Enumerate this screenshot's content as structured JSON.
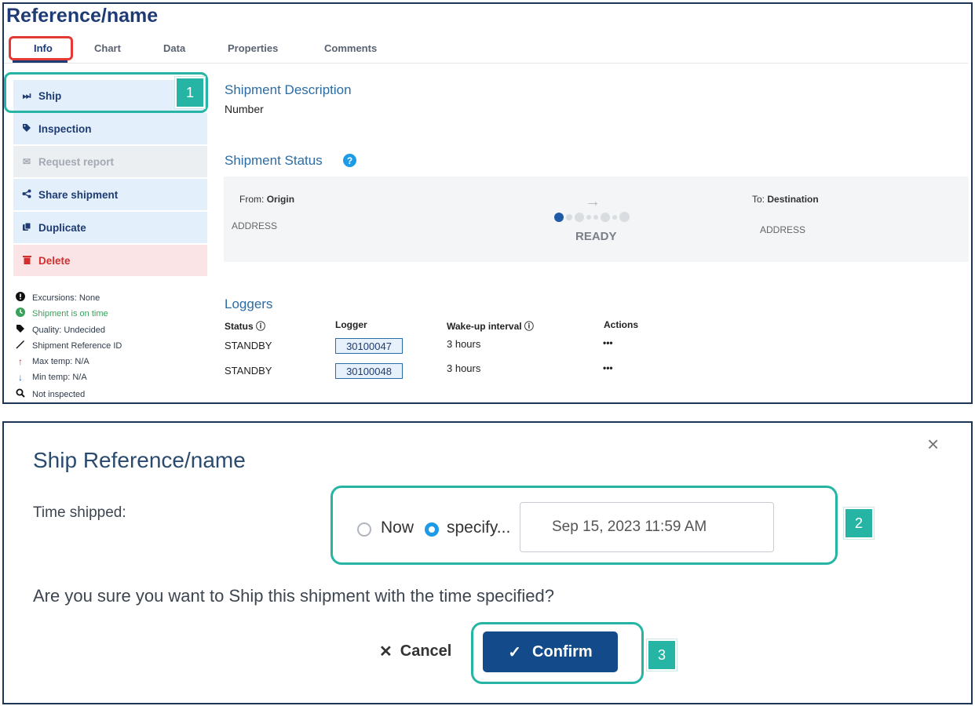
{
  "header": {
    "title": "Reference/name"
  },
  "tabs": [
    "Info",
    "Chart",
    "Data",
    "Properties",
    "Comments"
  ],
  "sidebar": {
    "actions": [
      {
        "label": "Ship",
        "icon": "fast-forward-icon"
      },
      {
        "label": "Inspection",
        "icon": "tag-icon"
      },
      {
        "label": "Request report",
        "icon": "envelope-icon"
      },
      {
        "label": "Share shipment",
        "icon": "share-icon"
      },
      {
        "label": "Duplicate",
        "icon": "copy-icon"
      },
      {
        "label": "Delete",
        "icon": "trash-icon"
      }
    ],
    "status": [
      {
        "text": "Excursions: None",
        "icon": "exclamation-icon"
      },
      {
        "text": "Shipment is on time",
        "icon": "clock-icon"
      },
      {
        "text": "Quality: Undecided",
        "icon": "tag-icon"
      },
      {
        "text": "Shipment Reference ID",
        "icon": "pen-icon"
      },
      {
        "text": "Max temp: N/A",
        "icon": "arrow-up-icon"
      },
      {
        "text": "Min temp: N/A",
        "icon": "arrow-down-icon"
      },
      {
        "text": "Not inspected",
        "icon": "search-icon"
      }
    ]
  },
  "callouts": {
    "one": "1",
    "two": "2",
    "three": "3"
  },
  "description": {
    "heading": "Shipment Description",
    "label": "Number"
  },
  "status": {
    "heading": "Shipment Status",
    "from_label": "From:",
    "from_value": "Origin",
    "from_address": "ADDRESS",
    "to_label": "To:",
    "to_value": "Destination",
    "to_address": "ADDRESS",
    "state": "READY"
  },
  "loggers": {
    "heading": "Loggers",
    "columns": [
      "Status ⓘ",
      "Logger",
      "Wake-up interval ⓘ",
      "Actions"
    ],
    "rows": [
      {
        "status": "STANDBY",
        "logger": "30100047",
        "interval": "3 hours",
        "actions": "•••"
      },
      {
        "status": "STANDBY",
        "logger": "30100048",
        "interval": "3 hours",
        "actions": "•••"
      }
    ]
  },
  "dialog": {
    "title": "Ship Reference/name",
    "time_label": "Time shipped:",
    "radio_now": "Now",
    "radio_specify": "specify...",
    "date_value": "Sep 15, 2023 11:59 AM",
    "question": "Are you sure you want to Ship this shipment with the time specified?",
    "cancel": "Cancel",
    "confirm": "Confirm"
  },
  "colors": {
    "accent": "#1f3b73",
    "teal_callout": "#26b5a5",
    "confirm_bg": "#124a8a",
    "delete": "#d32f2f"
  }
}
